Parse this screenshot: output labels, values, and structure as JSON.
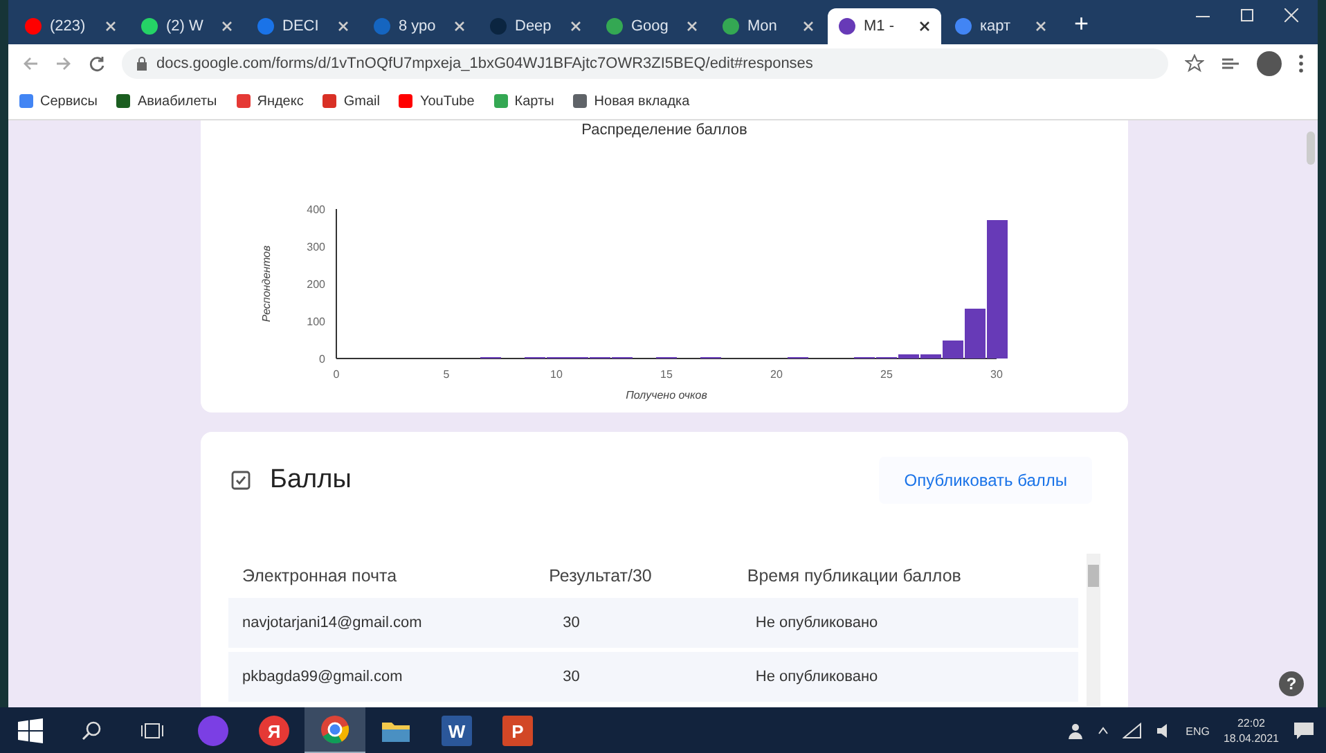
{
  "browser": {
    "tabs": [
      {
        "label": "(223)",
        "selected": false,
        "color": "#ff0000"
      },
      {
        "label": "(2) W",
        "selected": false,
        "color": "#25d366"
      },
      {
        "label": "DECI",
        "selected": false,
        "color": "#1a73e8"
      },
      {
        "label": "8 уро",
        "selected": false,
        "color": "#1565c0"
      },
      {
        "label": "Deep",
        "selected": false,
        "color": "#0b2540"
      },
      {
        "label": "Goog",
        "selected": false,
        "color": "#34a853"
      },
      {
        "label": "Mon",
        "selected": false,
        "color": "#34a853"
      },
      {
        "label": "M1 -",
        "selected": true,
        "color": "#673ab7"
      },
      {
        "label": "карт",
        "selected": false,
        "color": "#4285f4"
      }
    ],
    "new_tab": "+",
    "url": "docs.google.com/forms/d/1vTnOQfU7mpxeja_1bxG04WJ1BFAjtc7OWR3ZI5BEQ/edit#responses",
    "bookmarks": [
      {
        "label": "Сервисы",
        "color": "#4285f4"
      },
      {
        "label": "Авиабилеты",
        "color": "#1b5e20"
      },
      {
        "label": "Яндекс",
        "color": "#e53935"
      },
      {
        "label": "Gmail",
        "color": "#d93025"
      },
      {
        "label": "YouTube",
        "color": "#ff0000"
      },
      {
        "label": "Карты",
        "color": "#34a853"
      },
      {
        "label": "Новая вкладка",
        "color": "#5f6368"
      }
    ]
  },
  "distribution": {
    "title": "Распределение баллов",
    "chart_data": {
      "type": "bar",
      "xlabel": "Получено очков",
      "ylabel": "Респондентов",
      "x": [
        6,
        7,
        8,
        9,
        10,
        11,
        12,
        13,
        14,
        15,
        16,
        17,
        18,
        19,
        20,
        21,
        22,
        23,
        24,
        25,
        26,
        27,
        28,
        29,
        30
      ],
      "values": [
        1,
        3,
        1,
        4,
        2,
        4,
        3,
        4,
        1,
        3,
        1,
        3,
        1,
        1,
        1,
        3,
        1,
        1,
        4,
        4,
        10,
        12,
        50,
        135,
        370
      ],
      "xlim": [
        0,
        30
      ],
      "ylim": [
        0,
        400
      ],
      "xticks": [
        0,
        5,
        10,
        15,
        20,
        25,
        30
      ],
      "yticks": [
        0,
        100,
        200,
        300,
        400
      ]
    }
  },
  "scores": {
    "title": "Баллы",
    "publish_button": "Опубликовать баллы",
    "columns": [
      "Электронная почта",
      "Результат/30",
      "Время публикации баллов"
    ],
    "rows": [
      [
        "navjotarjani14@gmail.com",
        "30",
        "Не опубликовано"
      ],
      [
        "pkbagda99@gmail.com",
        "30",
        "Не опубликовано"
      ]
    ]
  },
  "help": "?",
  "taskbar": {
    "apps": [
      {
        "kind": "alice",
        "selected": false
      },
      {
        "kind": "yandex",
        "glyph": "Я",
        "selected": false
      },
      {
        "kind": "chrome",
        "selected": true
      },
      {
        "kind": "explorer",
        "selected": false
      },
      {
        "kind": "word",
        "glyph": "W",
        "selected": false
      },
      {
        "kind": "powerpoint",
        "glyph": "P",
        "selected": false
      }
    ],
    "language": "ENG",
    "time": "22:02",
    "date": "18.04.2021"
  }
}
